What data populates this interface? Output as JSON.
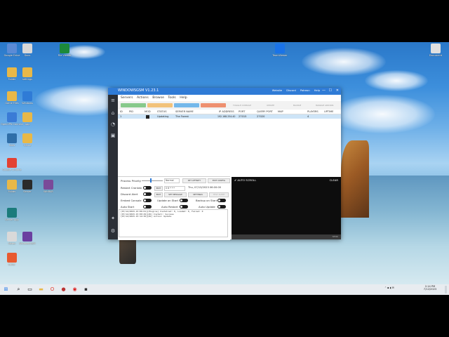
{
  "desktop": {
    "icons": [
      {
        "label": "Google Drive",
        "color": "#5b8bd6"
      },
      {
        "label": "Docs",
        "color": "#d9d9d9"
      },
      {
        "label": "File Viewer",
        "color": "#1c8a3a"
      },
      {
        "label": "Folder",
        "color": "#e8b848"
      },
      {
        "label": "settings",
        "color": "#e8b848"
      },
      {
        "label": "Game Files",
        "color": "#e8b848"
      },
      {
        "label": "Windows",
        "color": "#2f7bd6"
      },
      {
        "label": "OpenVPN Connect",
        "color": "#3a7bd6"
      },
      {
        "label": "App",
        "color": "#e8b848"
      },
      {
        "label": "Tools",
        "color": "#2f6ea8"
      },
      {
        "label": "Game",
        "color": "#e8b848"
      },
      {
        "label": "Google Chrome",
        "color": "#e34133"
      },
      {
        "label": "Folder",
        "color": "#e8b848"
      },
      {
        "label": "Server",
        "color": "#2a2a2a"
      },
      {
        "label": "WinRAR",
        "color": "#7a4a99"
      },
      {
        "label": "Server App",
        "color": "#1b7b7b"
      },
      {
        "label": "Notes",
        "color": "#d9d9d9"
      },
      {
        "label": "WindowsGSM",
        "color": "#6b3fa0"
      },
      {
        "label": "Editor",
        "color": "#e85a30"
      },
      {
        "label": "TeamViewer",
        "color": "#1a73e8"
      },
      {
        "label": "Document",
        "color": "#e0e0e0"
      },
      {
        "label": "Shortcut",
        "color": "#e0e0e0"
      }
    ]
  },
  "app": {
    "title": "WINDOWSGSM V1.23.1",
    "title_links": [
      "Website",
      "Discord",
      "Patreon",
      "Help"
    ],
    "win_controls": [
      "—",
      "☐",
      "✕"
    ],
    "menu": [
      "Servers",
      "Actions",
      "Browse",
      "Tools",
      "Help"
    ],
    "sidebar_icons": [
      "menu-icon",
      "home-icon",
      "dashboard-icon",
      "discord-icon",
      "plugin-icon",
      "settings-icon"
    ],
    "toolbar": {
      "colored_buttons": [
        {
          "name": "start",
          "color": "#87c98b"
        },
        {
          "name": "stop",
          "color": "#f2c27a"
        },
        {
          "name": "restart",
          "color": "#74b8ea"
        },
        {
          "name": "kill",
          "color": "#ee9070"
        }
      ],
      "text_buttons": [
        "TOGGLE CONSOLE",
        "UPDATE",
        "BACKUP",
        "MANAGE ADDONS"
      ]
    },
    "grid": {
      "columns": [
        "ID",
        "PID",
        "MOD",
        "STATUS",
        "SERVER NAME",
        "IP ADDRESS",
        "PORT",
        "QUERY PORT",
        "MAP",
        "PLAYERS",
        "UPTIME"
      ],
      "rows": [
        {
          "id": "1",
          "pid": "",
          "status": "Updating",
          "server_name": "The Forest",
          "ip": "192.168.254.40",
          "port": "27015",
          "query_port": "27020",
          "map": "",
          "players": "4",
          "uptime": ""
        }
      ]
    },
    "settings": {
      "process_priority_label": "Process Priority",
      "priority_value": "Normal",
      "set_affinity": "SET AFFINITY",
      "edit_config": "EDIT CONFIG",
      "restart_crontab_label": "Restart Crontab",
      "edit_1": "EDIT",
      "cron_value": "0 6 * * *",
      "next_restart": "Thu, 07/13/2023 06:00:00",
      "discord_alert_label": "Discord Alert",
      "edit_2": "EDIT",
      "set_message": "SET MESSAGE",
      "settings_btn": "SETTINGS",
      "test_alert": "TEST ALERT",
      "embed_console_label": "Embed Console",
      "update_on_start_label": "Update on Start",
      "backup_on_start_label": "Backup on Start",
      "auto_start_label": "Auto Start",
      "auto_restart_label": "Auto Restart",
      "auto_update_label": "Auto Update"
    },
    "log": [
      "[07/12/2023-15:06:01][Plugins] Installed: 0, Loaded: 0, Failed: 0",
      "[07/12/2023-15:09:49][#1] Install: Success",
      "[07/12/2023-15:14:36][#1] Action: Update"
    ],
    "console": {
      "auto_scroll": "AUTO SCROLL",
      "clear": "CLEAR",
      "send": "SEND"
    }
  },
  "taskbar": {
    "time": "2:14 PM",
    "date": "7/12/2023"
  }
}
